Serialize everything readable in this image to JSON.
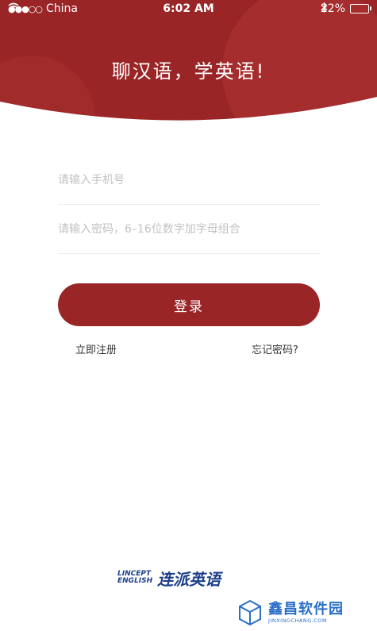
{
  "status_bar": {
    "carrier": "China",
    "time": "6:02 AM",
    "battery": "22%",
    "battery_level": 0.22
  },
  "header": {
    "slogan": "聊汉语，学英语!"
  },
  "form": {
    "phone_placeholder": "请输入手机号",
    "password_placeholder": "请输入密码，6–16位数字加字母组合",
    "login_label": "登录",
    "register_link": "立即注册",
    "forgot_link": "忘记密码?"
  },
  "footer": {
    "logo_en_line1": "LINCEPT",
    "logo_en_line2": "ENGLISH",
    "logo_zh": "连派英语"
  },
  "watermark": {
    "name": "鑫昌软件园",
    "domain": "JINXINGCHANG.COM"
  },
  "colors": {
    "brand": "#9a2527",
    "header_light": "#b0312f",
    "logo_blue": "#1d3f8a",
    "watermark_blue": "#2a6fc9"
  }
}
